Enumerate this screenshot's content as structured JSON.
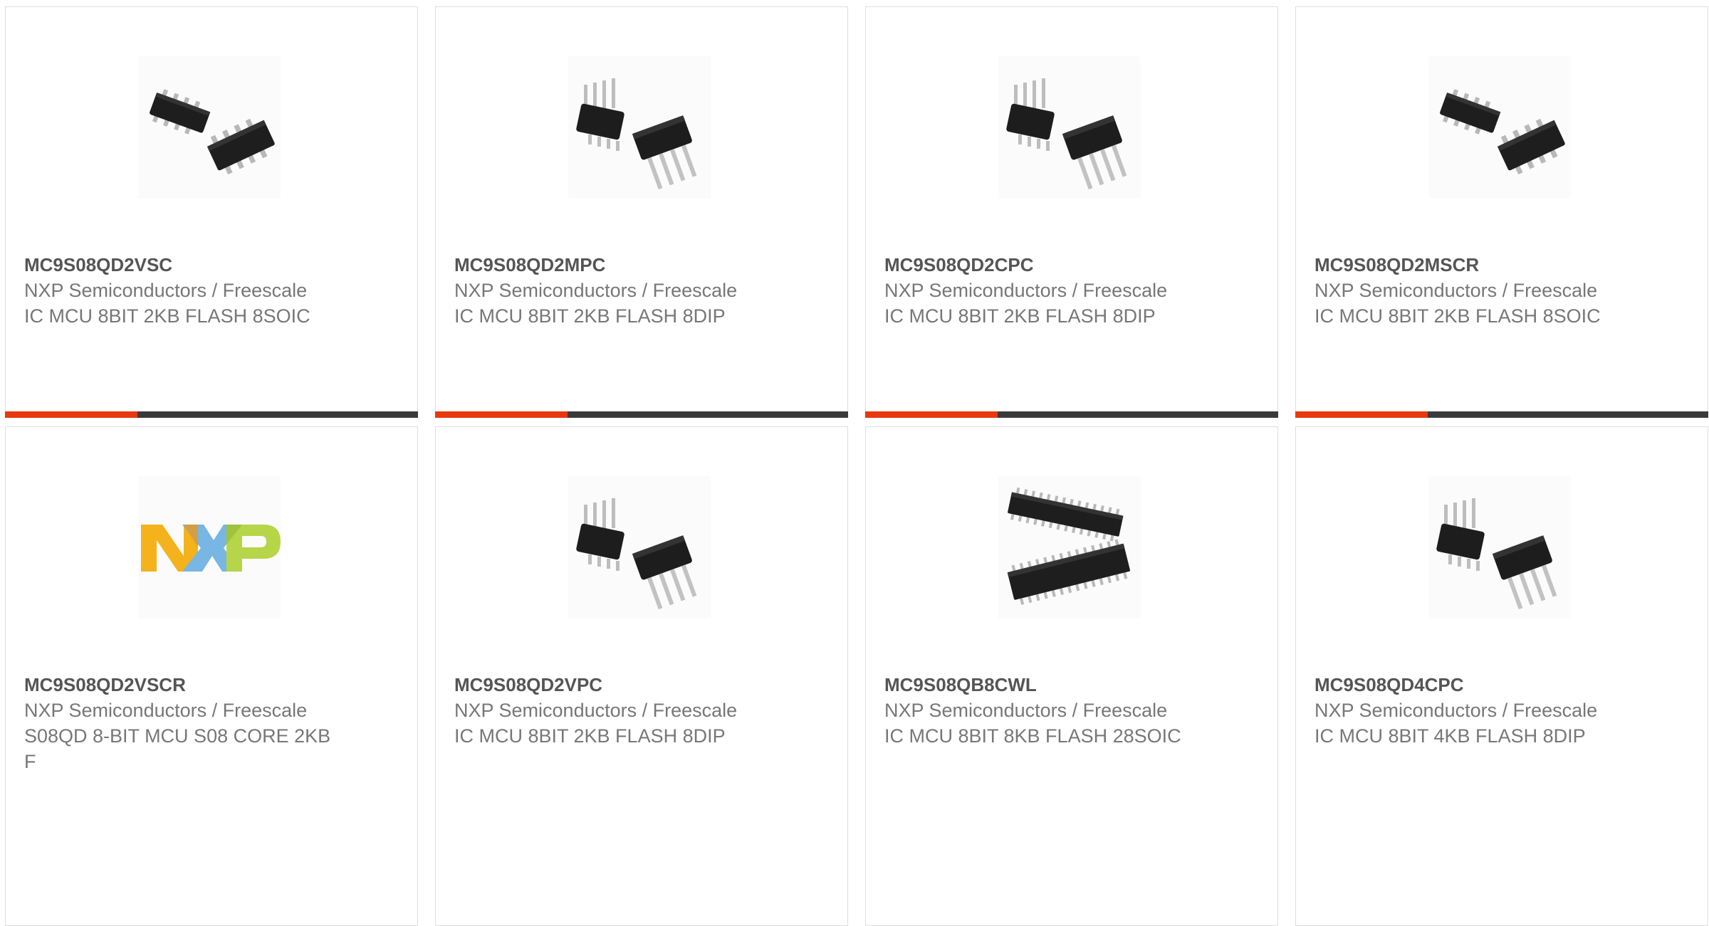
{
  "accent_color": "#e8380d",
  "track_color": "#3a3a3a",
  "products": [
    {
      "part_number": "MC9S08QD2VSC",
      "manufacturer": "NXP Semiconductors / Freescale",
      "description": "IC MCU 8BIT 2KB FLASH 8SOIC",
      "image": "soic-8-chip-icon",
      "progress": 0.32
    },
    {
      "part_number": "MC9S08QD2MPC",
      "manufacturer": "NXP Semiconductors / Freescale",
      "description": "IC MCU 8BIT 2KB FLASH 8DIP",
      "image": "dip-8-chip-icon",
      "progress": 0.32
    },
    {
      "part_number": "MC9S08QD2CPC",
      "manufacturer": "NXP Semiconductors / Freescale",
      "description": "IC MCU 8BIT 2KB FLASH 8DIP",
      "image": "dip-8-chip-icon",
      "progress": 0.32
    },
    {
      "part_number": "MC9S08QD2MSCR",
      "manufacturer": "NXP Semiconductors / Freescale",
      "description": "IC MCU 8BIT 2KB FLASH 8SOIC",
      "image": "soic-8-chip-icon",
      "progress": 0.32
    },
    {
      "part_number": "MC9S08QD2VSCR",
      "manufacturer": "NXP Semiconductors / Freescale",
      "description": "S08QD 8-BIT MCU S08 CORE 2KB F",
      "image": "nxp-logo"
    },
    {
      "part_number": "MC9S08QD2VPC",
      "manufacturer": "NXP Semiconductors / Freescale",
      "description": "IC MCU 8BIT 2KB FLASH 8DIP",
      "image": "dip-8-chip-icon"
    },
    {
      "part_number": "MC9S08QB8CWL",
      "manufacturer": "NXP Semiconductors / Freescale",
      "description": "IC MCU 8BIT 8KB FLASH 28SOIC",
      "image": "soic-28-chip-icon"
    },
    {
      "part_number": "MC9S08QD4CPC",
      "manufacturer": "NXP Semiconductors / Freescale",
      "description": "IC MCU 8BIT 4KB FLASH 8DIP",
      "image": "dip-8-chip-icon"
    }
  ]
}
